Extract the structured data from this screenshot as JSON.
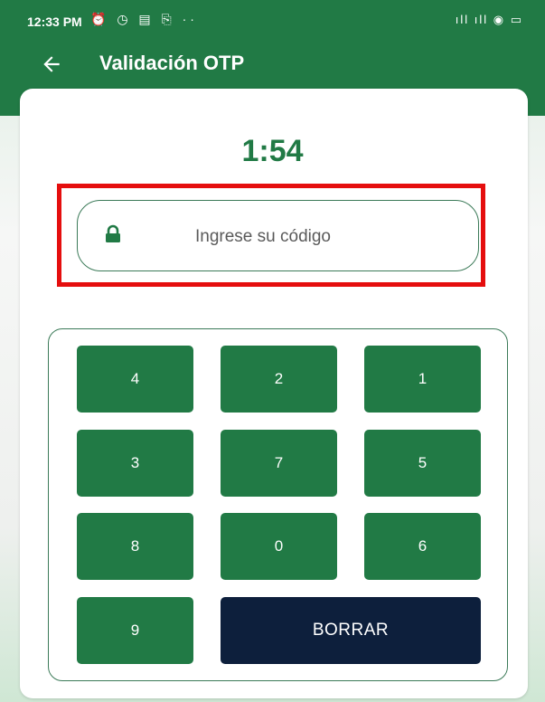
{
  "status_bar": {
    "time": "12:33 PM",
    "notification_icons": "⏰ ◷ ▤ ⎘ ··",
    "system_icons": "ıll ıll ◉ ▭"
  },
  "header": {
    "title": "Validación OTP",
    "back_icon": "arrow-left-icon"
  },
  "timer": "1:54",
  "otp_input": {
    "placeholder": "Ingrese su código",
    "icon": "lock-icon"
  },
  "keypad": {
    "keys": [
      "4",
      "2",
      "1",
      "3",
      "7",
      "5",
      "8",
      "0",
      "6",
      "9"
    ],
    "delete_label": "BORRAR"
  },
  "colors": {
    "primary": "#217a45",
    "dark_button": "#0d1f3c",
    "highlight": "#e50e0e"
  }
}
